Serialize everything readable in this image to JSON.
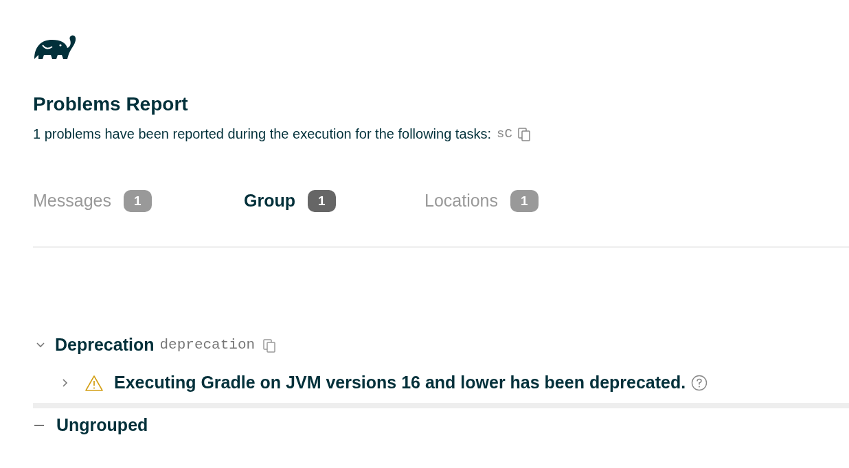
{
  "title": "Problems Report",
  "summary": {
    "text": "1 problems have been reported during the execution for the following tasks:",
    "tasks": "sC"
  },
  "tabs": [
    {
      "label": "Messages",
      "count": "1",
      "selected": false
    },
    {
      "label": "Group",
      "count": "1",
      "selected": true
    },
    {
      "label": "Locations",
      "count": "1",
      "selected": false
    }
  ],
  "tree": [
    {
      "kind": "group",
      "label": "Deprecation",
      "id_text": "deprecation",
      "expanded": true,
      "children": [
        {
          "kind": "warning",
          "label": "Executing Gradle on JVM versions 16 and lower has been deprecated.",
          "expanded": false
        }
      ]
    },
    {
      "kind": "empty",
      "label": "Ungrouped"
    }
  ]
}
